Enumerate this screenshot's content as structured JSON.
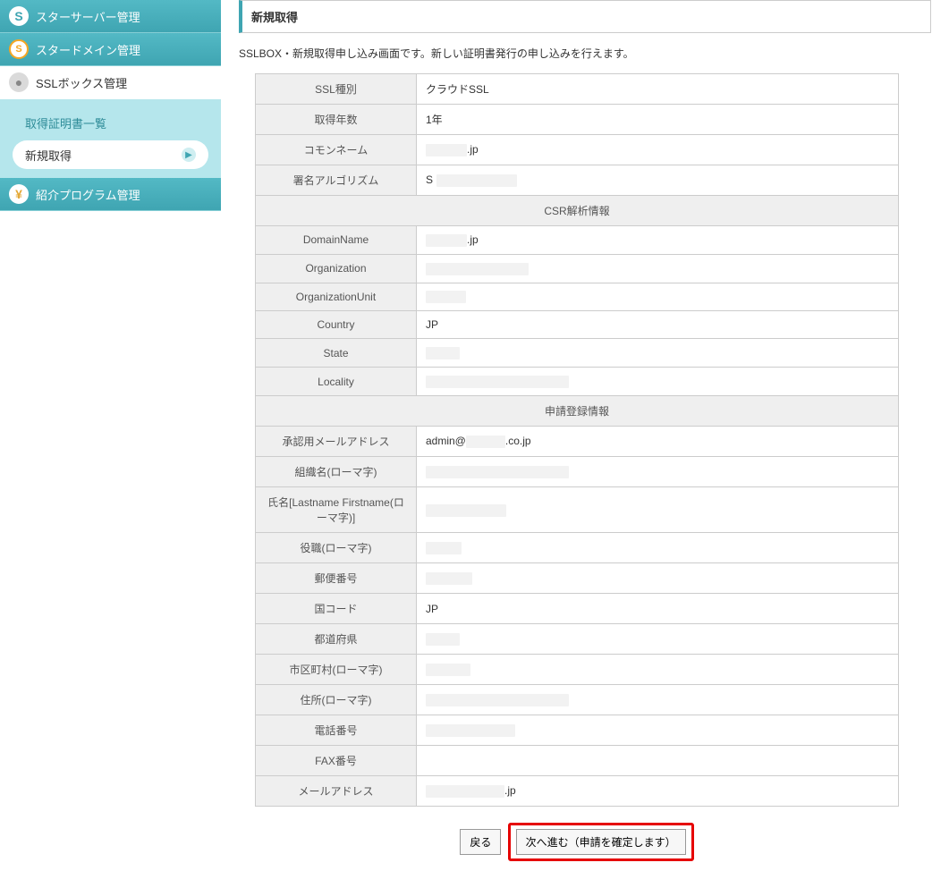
{
  "sidebar": {
    "items": [
      {
        "label": "スターサーバー管理",
        "icon": "S"
      },
      {
        "label": "スタードメイン管理",
        "icon": "S"
      },
      {
        "label": "SSLボックス管理",
        "icon": "●"
      },
      {
        "label": "紹介プログラム管理",
        "icon": "¥"
      }
    ],
    "sub": [
      {
        "label": "取得証明書一覧"
      },
      {
        "label": "新規取得"
      }
    ]
  },
  "page": {
    "title": "新規取得",
    "description": "SSLBOX・新規取得申し込み画面です。新しい証明書発行の申し込みを行えます。"
  },
  "rows": {
    "ssl_type_label": "SSL種別",
    "ssl_type_value": "クラウドSSL",
    "years_label": "取得年数",
    "years_value": "1年",
    "common_name_label": "コモンネーム",
    "common_name_suffix": ".jp",
    "sig_alg_label": "署名アルゴリズム",
    "sig_alg_prefix": "S",
    "csr_section": "CSR解析情報",
    "domain_name_label": "DomainName",
    "domain_name_suffix": ".jp",
    "org_label": "Organization",
    "org_unit_label": "OrganizationUnit",
    "country_label": "Country",
    "country_value": "JP",
    "state_label": "State",
    "locality_label": "Locality",
    "app_section": "申請登録情報",
    "approval_email_label": "承認用メールアドレス",
    "approval_email_prefix": "admin@",
    "approval_email_suffix": ".co.jp",
    "org_roman_label": "組織名(ローマ字)",
    "name_roman_label": "氏名[Lastname Firstname(ローマ字)]",
    "title_roman_label": "役職(ローマ字)",
    "postal_label": "郵便番号",
    "country_code_label": "国コード",
    "country_code_value": "JP",
    "prefecture_label": "都道府県",
    "city_roman_label": "市区町村(ローマ字)",
    "address_roman_label": "住所(ローマ字)",
    "phone_label": "電話番号",
    "fax_label": "FAX番号",
    "email_label": "メールアドレス",
    "email_suffix": ".jp"
  },
  "buttons": {
    "back": "戻る",
    "next": "次へ進む（申請を確定します）"
  }
}
